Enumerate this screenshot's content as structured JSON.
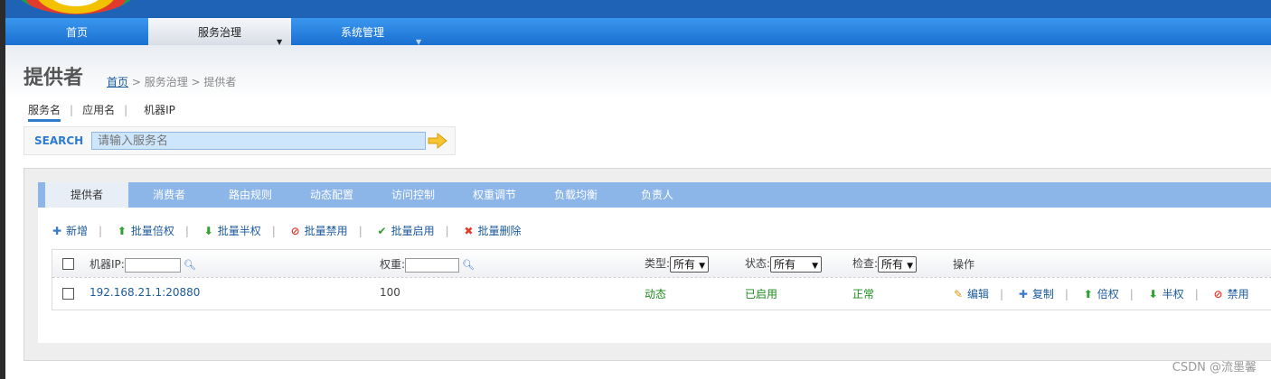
{
  "nav": {
    "home": "首页",
    "service_governance": "服务治理",
    "system_management": "系统管理"
  },
  "page": {
    "title": "提供者",
    "breadcrumb": {
      "home": "首页",
      "rest": " > 服务治理 > 提供者"
    }
  },
  "filter_tabs": [
    "服务名",
    "应用名",
    "机器IP"
  ],
  "search": {
    "label": "SEARCH",
    "placeholder": "请输入服务名"
  },
  "tabs": [
    "提供者",
    "消费者",
    "路由规则",
    "动态配置",
    "访问控制",
    "权重调节",
    "负载均衡",
    "负责人"
  ],
  "toolbar": [
    {
      "label": "新增",
      "icon": "plus-icon"
    },
    {
      "label": "批量倍权",
      "icon": "arrow-up-icon"
    },
    {
      "label": "批量半权",
      "icon": "arrow-down-icon"
    },
    {
      "label": "批量禁用",
      "icon": "forbidden-icon"
    },
    {
      "label": "批量启用",
      "icon": "check-icon"
    },
    {
      "label": "批量删除",
      "icon": "delete-icon"
    }
  ],
  "grid": {
    "headers": {
      "machine_ip": "机器IP:",
      "weight": "权重:",
      "type": "类型:",
      "type_value": "所有",
      "status": "状态:",
      "status_value": "所有",
      "check": "检查:",
      "check_value": "所有",
      "ops": "操作"
    },
    "rows": [
      {
        "address": "192.168.21.1:20880",
        "weight": "100",
        "type": "动态",
        "status": "已启用",
        "check": "正常",
        "ops": [
          "编辑",
          "复制",
          "倍权",
          "半权",
          "禁用"
        ]
      }
    ]
  },
  "watermark": "CSDN @流墨馨",
  "colors": {
    "nav_blue": "#1a6fd0",
    "tab_bar": "#8cb5e8",
    "link": "#1c5a9b",
    "status_green": "#1e8a1e",
    "add_blue": "#3a7ac8",
    "arrow_green": "#2ea12e",
    "delete_red": "#e23b2e"
  }
}
